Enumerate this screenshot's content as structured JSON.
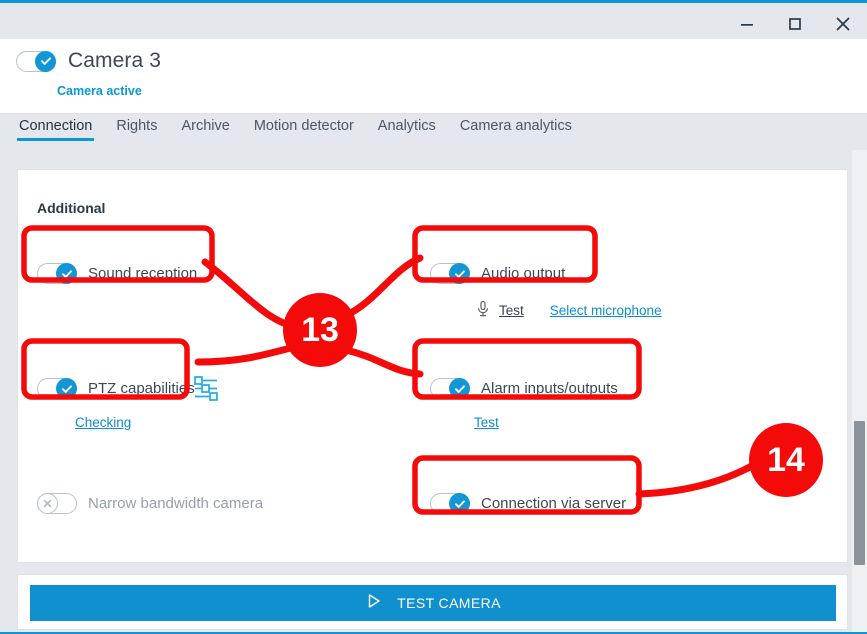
{
  "window": {
    "accent_color": "#0b97d4",
    "controls": [
      {
        "name": "minimize",
        "glyph": "minimize-icon"
      },
      {
        "name": "maximize",
        "glyph": "maximize-icon"
      },
      {
        "name": "close",
        "glyph": "close-icon"
      }
    ]
  },
  "header": {
    "title": "Camera 3",
    "status": "Camera active",
    "status_color": "#0b97d4",
    "enabled": true
  },
  "tabs": [
    {
      "label": "Connection",
      "active": true
    },
    {
      "label": "Rights",
      "active": false
    },
    {
      "label": "Archive",
      "active": false
    },
    {
      "label": "Motion detector",
      "active": false
    },
    {
      "label": "Analytics",
      "active": false
    },
    {
      "label": "Camera analytics",
      "active": false
    }
  ],
  "section": {
    "title": "Additional"
  },
  "options": {
    "sound_reception": {
      "label": "Sound reception",
      "on": true
    },
    "audio_output": {
      "label": "Audio output",
      "on": true
    },
    "audio_output_test": "Test",
    "audio_output_select": "Select microphone",
    "ptz": {
      "label": "PTZ capabilities",
      "on": true
    },
    "ptz_checking": "Checking",
    "alarm_io": {
      "label": "Alarm inputs/outputs",
      "on": true
    },
    "alarm_io_test": "Test",
    "narrow_bandwidth": {
      "label": "Narrow bandwidth camera",
      "on": false
    },
    "connection_via_server": {
      "label": "Connection via server",
      "on": true
    }
  },
  "footer": {
    "test_camera_label": "TEST CAMERA",
    "test_camera_color": "#1190cf"
  },
  "annotations": {
    "color": "#f50a0a",
    "badges": [
      {
        "number": "13"
      },
      {
        "number": "14"
      }
    ]
  }
}
